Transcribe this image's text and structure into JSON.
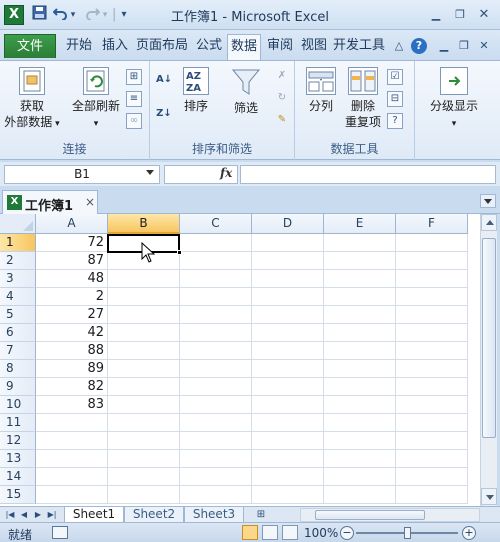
{
  "window": {
    "title": "工作簿1 - Microsoft Excel",
    "app_icon_letter": "X"
  },
  "quick_access": {
    "save_icon": "save-icon",
    "undo_icon": "undo-icon",
    "redo_icon": "redo-icon",
    "customize_icon": "customize-qat-icon"
  },
  "ribbon_tabs": {
    "file": "文件",
    "tabs": [
      "开始",
      "插入",
      "页面布局",
      "公式",
      "数据",
      "审阅",
      "视图",
      "开发工具"
    ],
    "active": "数据"
  },
  "ribbon": {
    "groups": [
      {
        "label": "连接",
        "buttons": [
          {
            "label": "获取",
            "label2": "外部数据",
            "icon": "get-external-data-icon"
          },
          {
            "label": "全部刷新",
            "icon": "refresh-all-icon"
          }
        ]
      },
      {
        "label": "排序和筛选",
        "buttons": [
          {
            "label": "排序",
            "icon": "sort-icon"
          },
          {
            "label": "筛选",
            "icon": "filter-icon"
          }
        ]
      },
      {
        "label": "数据工具",
        "buttons": [
          {
            "label": "分列",
            "icon": "text-to-columns-icon"
          },
          {
            "label": "删除",
            "label2": "重复项",
            "icon": "remove-duplicates-icon"
          }
        ]
      },
      {
        "label": "",
        "buttons": [
          {
            "label": "分级显示",
            "icon": "outline-icon"
          }
        ]
      }
    ]
  },
  "formula_bar": {
    "name_box": "B1",
    "fx_label": "fx",
    "formula": ""
  },
  "workbook_tab": {
    "title": "工作簿1",
    "close": "×"
  },
  "sheet": {
    "columns": [
      "A",
      "B",
      "C",
      "D",
      "E",
      "F"
    ],
    "selected_column": "B",
    "rows": [
      "1",
      "2",
      "3",
      "4",
      "5",
      "6",
      "7",
      "8",
      "9",
      "10",
      "11",
      "12",
      "13",
      "14",
      "15"
    ],
    "selected_row": "1",
    "column_a_values": [
      "72",
      "87",
      "48",
      "2",
      "27",
      "42",
      "88",
      "89",
      "82",
      "83",
      "",
      "",
      "",
      "",
      ""
    ],
    "active_cell": "B1"
  },
  "sheet_tabs": {
    "tabs": [
      "Sheet1",
      "Sheet2",
      "Sheet3"
    ],
    "active": "Sheet1"
  },
  "status_bar": {
    "status": "就绪",
    "zoom": "100%",
    "zoom_minus": "−",
    "zoom_plus": "+"
  },
  "colors": {
    "file_tab": "#2b7d36",
    "selected_header": "#f7c660",
    "ribbon_bg": "#dfeaf7"
  }
}
